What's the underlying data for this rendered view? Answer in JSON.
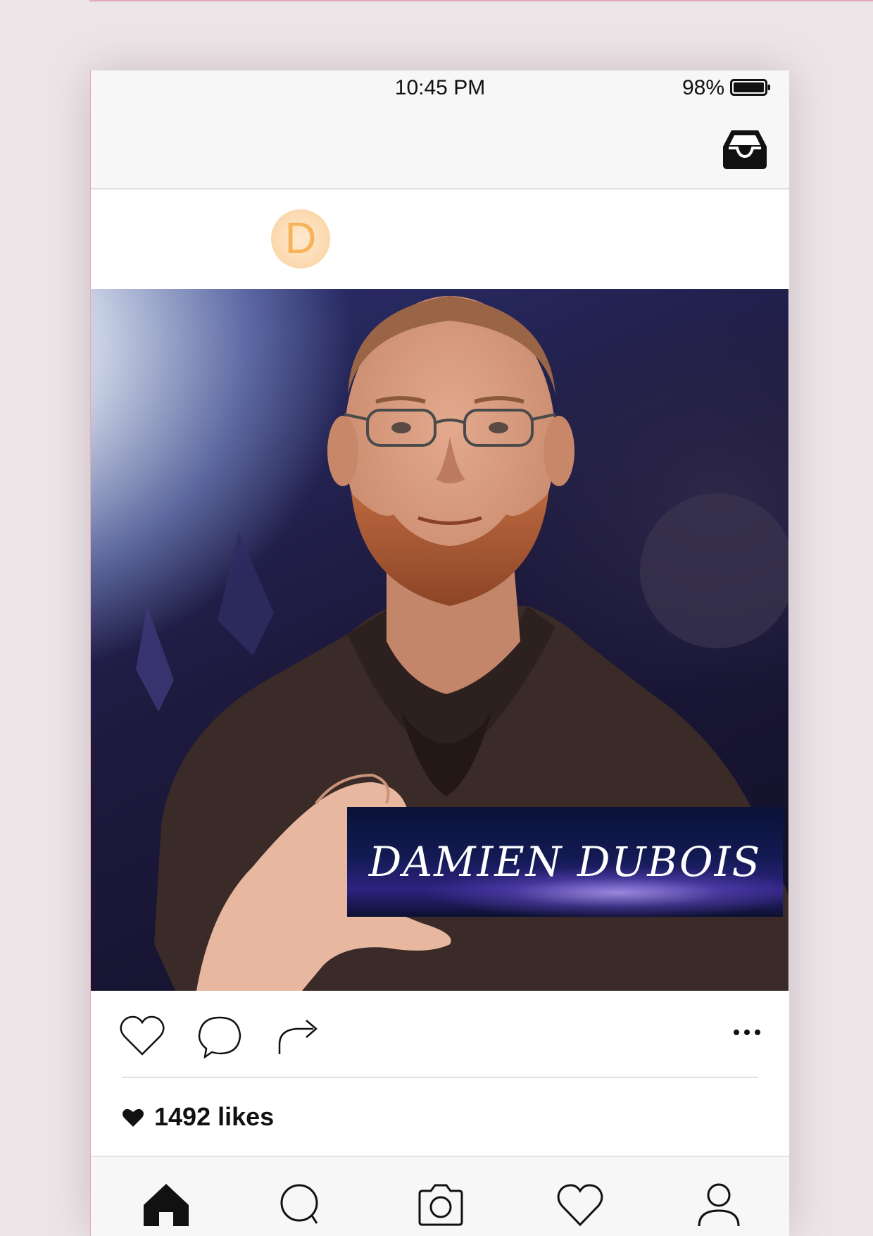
{
  "status_bar": {
    "time": "10:45 PM",
    "battery": "98%"
  },
  "header": {
    "inbox_icon": "inbox-icon"
  },
  "post": {
    "avatar_initial": "D",
    "name_card_text": "DAMIEN DUBOIS",
    "likes_text": "1492 likes"
  },
  "actions": [
    "heart-icon",
    "comment-icon",
    "share-icon",
    "more-icon"
  ],
  "tab_bar": [
    "home-icon",
    "search-icon",
    "camera-icon",
    "heart-icon",
    "profile-icon"
  ],
  "colors": {
    "avatar_letter": "#f6b35c",
    "accent_border": "#e3a9bc",
    "background": "#ede6e9"
  }
}
